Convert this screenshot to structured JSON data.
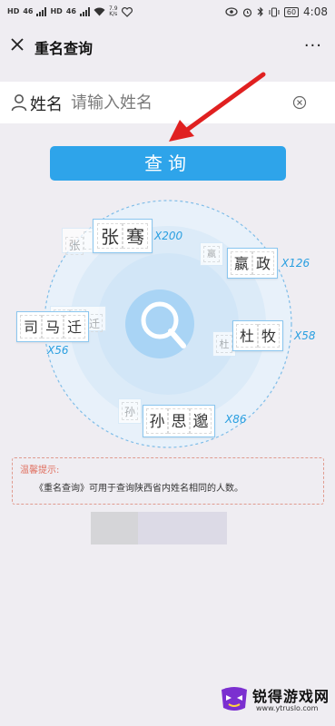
{
  "status_bar": {
    "left_tags": [
      "HD",
      "HD"
    ],
    "signal": [
      "46",
      "46"
    ],
    "net_speed_top": "7.9",
    "net_speed_bottom": "K/s",
    "battery": "60",
    "time": "4:08"
  },
  "header": {
    "title": "重名查询",
    "more": "···"
  },
  "search": {
    "label": "姓名",
    "placeholder": "请输入姓名",
    "value": ""
  },
  "query_button": {
    "label": "查询"
  },
  "illustration": {
    "cards": [
      {
        "chars": [
          "张",
          "骞"
        ],
        "count": "X200",
        "ghost": [
          "张"
        ]
      },
      {
        "chars": [
          "嬴",
          "政"
        ],
        "count": "X126",
        "ghost": [
          "嬴"
        ]
      },
      {
        "chars": [
          "司",
          "马",
          "迁"
        ],
        "count": "X56",
        "ghost": [
          "迁"
        ]
      },
      {
        "chars": [
          "杜",
          "牧"
        ],
        "count": "X58",
        "ghost": [
          "杜"
        ]
      },
      {
        "chars": [
          "孙",
          "思",
          "邈"
        ],
        "count": "X86",
        "ghost": [
          "孙"
        ]
      }
    ]
  },
  "tip": {
    "title": "温馨提示:",
    "text": "《重名查询》可用于查询陕西省内姓名相同的人数。"
  },
  "watermark": {
    "title": "锐得游戏网",
    "url": "www.ytruslo.com"
  },
  "colors": {
    "primary": "#2ea4ea",
    "annotation_arrow": "#e02020",
    "tip_border": "#e09b8f"
  }
}
